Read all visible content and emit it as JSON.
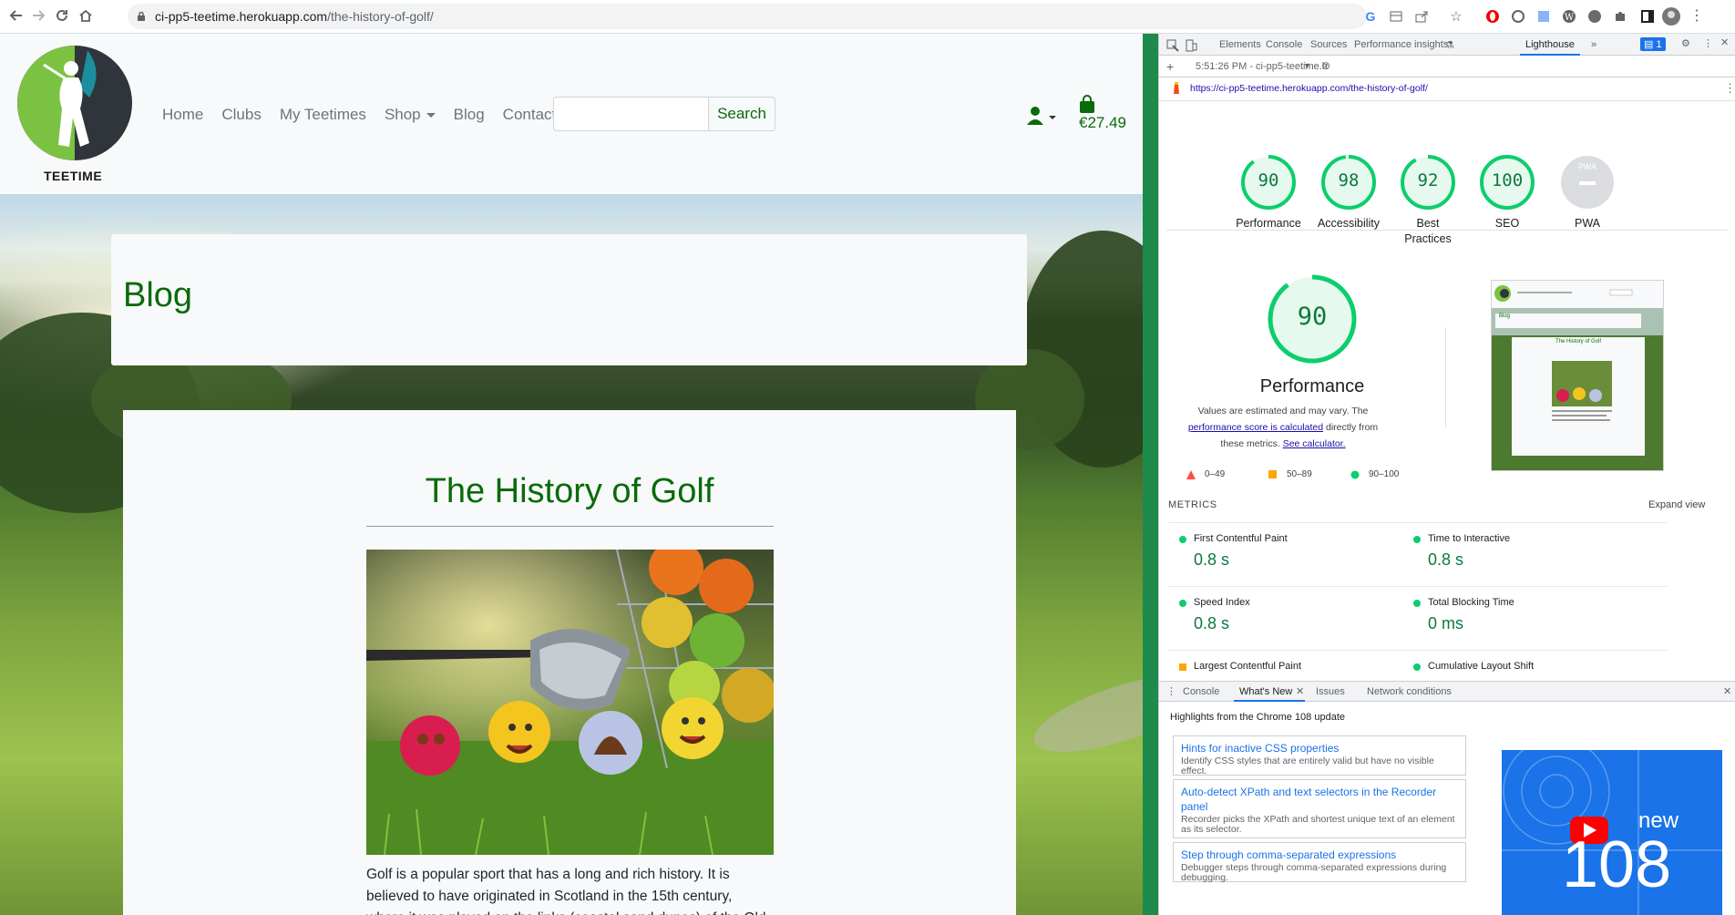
{
  "browser": {
    "url_host": "ci-pp5-teetime.herokuapp.com",
    "url_path": "/the-history-of-golf/"
  },
  "site": {
    "logo_text": "TEETIME",
    "nav": [
      "Home",
      "Clubs",
      "My Teetimes",
      "Shop",
      "Blog",
      "Contact"
    ],
    "search_button": "Search",
    "search_placeholder": "",
    "cart_total": "€27.49",
    "banner_title": "Blog",
    "article_title": "The History of Golf",
    "article_text": "Golf is a popular sport that has a long and rich history. It is believed to have originated in Scotland in the 15th century, where it was played on the links (coastal sand dunes) of the Old Course at St. Andrews. The game is played with a small,"
  },
  "devtools": {
    "tabs": [
      "Elements",
      "Console",
      "Sources",
      "Performance insights",
      "Lighthouse"
    ],
    "active_tab": "Lighthouse",
    "issues_badge": "1",
    "report_time": "5:51:26 PM - ci-pp5-teetime.h",
    "report_url": "https://ci-pp5-teetime.herokuapp.com/the-history-of-golf/",
    "scores": [
      {
        "label": "Performance",
        "value": 90
      },
      {
        "label": "Accessibility",
        "value": 98
      },
      {
        "label": "Best Practices",
        "value": 92
      },
      {
        "label": "SEO",
        "value": 100
      },
      {
        "label": "PWA",
        "value": null
      }
    ],
    "pwa_badge": "PWA",
    "perf_score": "90",
    "perf_label": "Performance",
    "perf_desc_1": "Values are estimated and may vary. The ",
    "perf_desc_link1": "performance score is calculated",
    "perf_desc_2": " directly from these metrics. ",
    "perf_desc_link2": "See calculator.",
    "legend": [
      "0–49",
      "50–89",
      "90–100"
    ],
    "metrics_header": "METRICS",
    "expand_view": "Expand view",
    "metrics": [
      {
        "name": "First Contentful Paint",
        "value": "0.8 s",
        "status": "pass"
      },
      {
        "name": "Time to Interactive",
        "value": "0.8 s",
        "status": "pass"
      },
      {
        "name": "Speed Index",
        "value": "0.8 s",
        "status": "pass"
      },
      {
        "name": "Total Blocking Time",
        "value": "0 ms",
        "status": "pass"
      },
      {
        "name": "Largest Contentful Paint",
        "value": "",
        "status": "average"
      },
      {
        "name": "Cumulative Layout Shift",
        "value": "",
        "status": "pass"
      }
    ],
    "thumb_title": "The History of Golf",
    "thumb_blog": "Blog",
    "drawer": {
      "tabs": [
        "Console",
        "What's New",
        "Issues",
        "Network conditions"
      ],
      "active_tab": "What's New",
      "heading": "Highlights from the Chrome 108 update",
      "news": [
        {
          "title": "Hints for inactive CSS properties",
          "desc": "Identify CSS styles that are entirely valid but have no visible effect."
        },
        {
          "title": "Auto-detect XPath and text selectors in the Recorder panel",
          "desc": "Recorder picks the XPath and shortest unique text of an element as its selector."
        },
        {
          "title": "Step through comma-separated expressions",
          "desc": "Debugger steps through comma-separated expressions during debugging."
        }
      ],
      "video_new": "new",
      "video_version": "108"
    }
  },
  "colors": {
    "brand_green": "#0a6b0a",
    "score_green": "#0cce6b",
    "score_orange": "#ffa400",
    "score_red": "#ff4e42"
  }
}
